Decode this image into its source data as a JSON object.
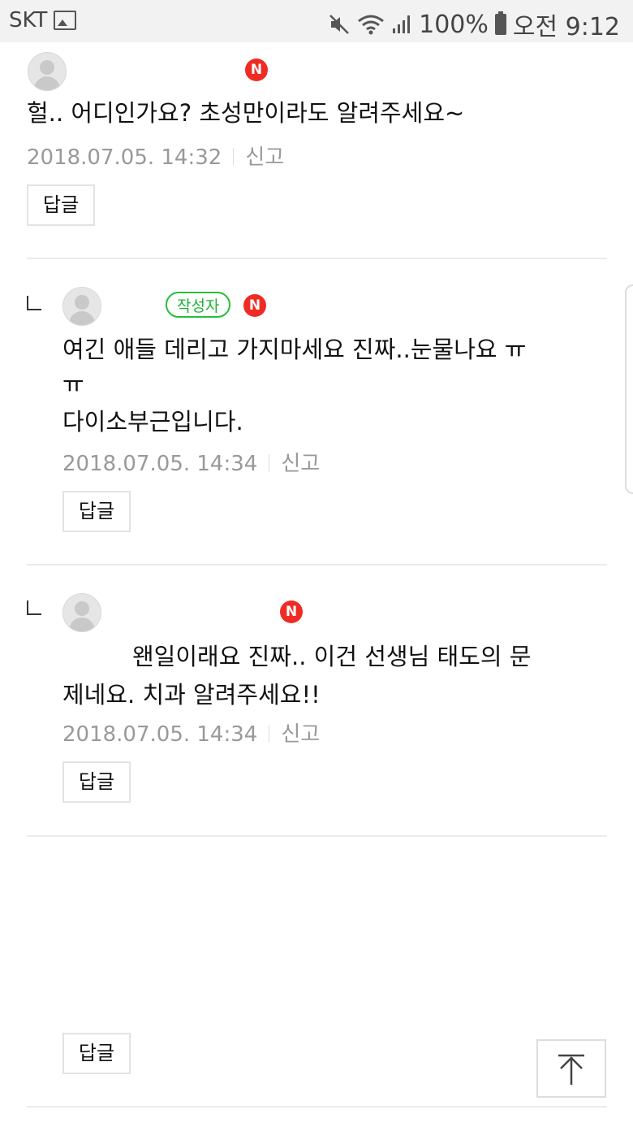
{
  "status_bar": {
    "carrier": "SKT",
    "battery_text": "100%",
    "time": "오전 9:12",
    "icons": [
      "image-icon",
      "mute-icon",
      "wifi-icon",
      "signal-icon",
      "battery-icon"
    ]
  },
  "comments": [
    {
      "text": "헐.. 어디인가요? 초성만이라도 알려주세요~",
      "date": "2018.07.05. 14:32",
      "report": "신고",
      "reply": "답글",
      "badge_new": "N"
    },
    {
      "author_badge": "작성자",
      "text_line1": "여긴 애들 데리고 가지마세요 진짜..눈물나요 ㅠ",
      "text_line2": "ㅠ",
      "text_line3": "다이소부근입니다.",
      "date": "2018.07.05. 14:34",
      "report": "신고",
      "reply": "답글",
      "badge_new": "N"
    },
    {
      "text_line1": "왠일이래요 진짜.. 이건 선생님 태도의 문",
      "text_line2": "제네요. 치과 알려주세요!!",
      "date": "2018.07.05. 14:34",
      "report": "신고",
      "reply": "답글",
      "badge_new": "N"
    },
    {
      "reply": "답글"
    }
  ],
  "colors": {
    "new_badge": "#ef2b24",
    "author_badge": "#22c03a",
    "meta_text": "#999999",
    "divider": "#ebebeb"
  }
}
